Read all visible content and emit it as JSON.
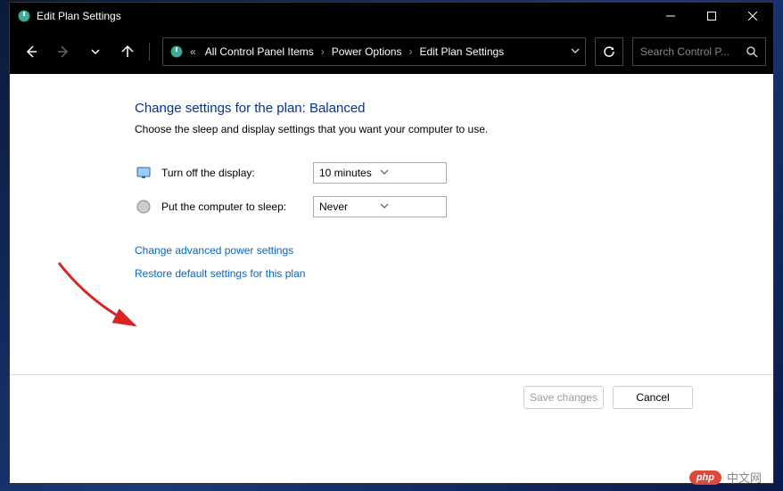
{
  "titlebar": {
    "title": "Edit Plan Settings"
  },
  "breadcrumb": {
    "prefix": "«",
    "items": [
      "All Control Panel Items",
      "Power Options",
      "Edit Plan Settings"
    ]
  },
  "search": {
    "placeholder": "Search Control P..."
  },
  "page": {
    "heading": "Change settings for the plan: Balanced",
    "subheading": "Choose the sleep and display settings that you want your computer to use."
  },
  "settings": {
    "display": {
      "label": "Turn off the display:",
      "value": "10 minutes"
    },
    "sleep": {
      "label": "Put the computer to sleep:",
      "value": "Never"
    }
  },
  "links": {
    "advanced": "Change advanced power settings",
    "restore": "Restore default settings for this plan"
  },
  "buttons": {
    "save": "Save changes",
    "cancel": "Cancel"
  },
  "watermark": {
    "badge": "php",
    "text": "中文网"
  }
}
